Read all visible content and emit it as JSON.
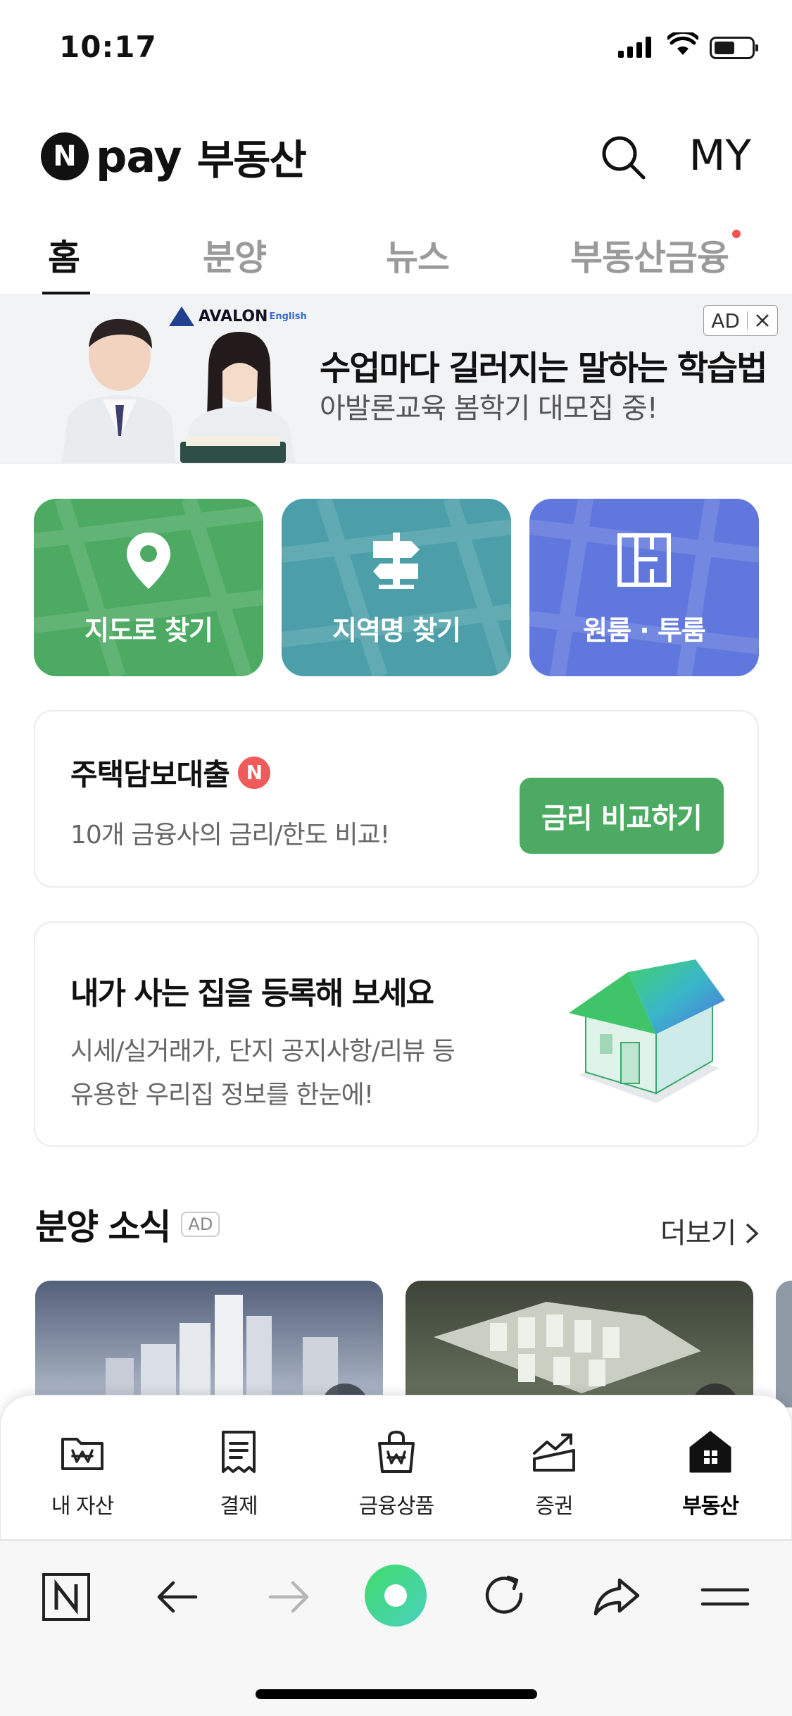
{
  "status_bar": {
    "time": "10:17"
  },
  "header": {
    "brand_pay": "pay",
    "brand_title": "부동산",
    "brand_logo_letter": "N",
    "my_label": "MY"
  },
  "tabs": [
    {
      "label": "홈",
      "active": true
    },
    {
      "label": "분양",
      "active": false
    },
    {
      "label": "뉴스",
      "active": false
    },
    {
      "label": "부동산금융",
      "active": false,
      "has_dot": true
    }
  ],
  "ad_banner": {
    "logo": "AVALON",
    "logo_sub": "English",
    "title": "수업마다 길러지는 말하는 학습법",
    "subtitle": "아발론교육 봄학기 대모집 중!",
    "badge": "AD"
  },
  "quick_actions": [
    {
      "label": "지도로 찾기",
      "icon": "map-pin-icon",
      "color": "#4caa62"
    },
    {
      "label": "지역명 찾기",
      "icon": "signpost-icon",
      "color": "#4c9fa9"
    },
    {
      "label": "원룸 · 투룸",
      "icon": "floorplan-icon",
      "color": "#6077dd"
    }
  ],
  "loan_card": {
    "title": "주택담보대출",
    "badge": "N",
    "subtitle": "10개 금융사의 금리/한도 비교!",
    "cta": "금리 비교하기"
  },
  "home_card": {
    "title": "내가 사는 집을 등록해 보세요",
    "line1": "시세/실거래가, 단지 공지사항/리뷰 등",
    "line2": "유용한 우리집 정보를 한눈에!"
  },
  "presale_section": {
    "title": "분양 소식",
    "ad_tag": "AD",
    "more": "더보기"
  },
  "bottom_nav": [
    {
      "label": "내 자산",
      "icon": "wallet-folder-icon"
    },
    {
      "label": "결제",
      "icon": "receipt-icon"
    },
    {
      "label": "금융상품",
      "icon": "shopping-bag-icon"
    },
    {
      "label": "증권",
      "icon": "chart-up-icon"
    },
    {
      "label": "부동산",
      "icon": "house-icon",
      "active": true
    }
  ],
  "browser_toolbar": {
    "buttons": [
      "naver-home-icon",
      "back-icon",
      "forward-icon",
      "green-dot-icon",
      "reload-icon",
      "share-icon",
      "menu-icon"
    ]
  },
  "colors": {
    "green": "#4caa62",
    "teal": "#4c9fa9",
    "blue": "#6077dd",
    "notice_red": "#f25353"
  }
}
